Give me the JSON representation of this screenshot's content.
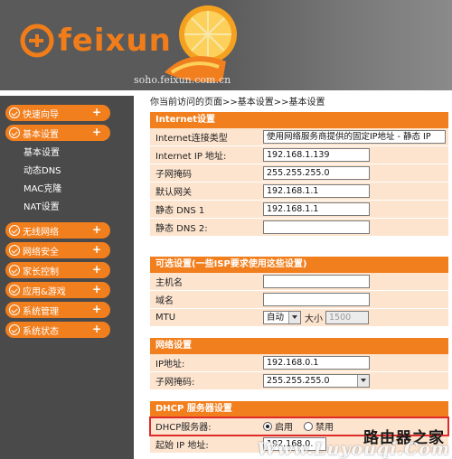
{
  "header": {
    "brand": "feixun",
    "domain": "soho.feixun.com.cn",
    "brand_color": "#f07d1a"
  },
  "sidebar": {
    "items": [
      {
        "label": "快速向导",
        "icon": "check-circle-icon"
      },
      {
        "label": "基本设置",
        "icon": "check-circle-icon"
      },
      {
        "label": "无线网络",
        "icon": "check-circle-icon"
      },
      {
        "label": "网络安全",
        "icon": "check-circle-icon"
      },
      {
        "label": "家长控制",
        "icon": "check-circle-icon"
      },
      {
        "label": "应用&游戏",
        "icon": "check-circle-icon"
      },
      {
        "label": "系统管理",
        "icon": "check-circle-icon"
      },
      {
        "label": "系统状态",
        "icon": "check-circle-icon"
      }
    ],
    "plus": "+",
    "basic_sub": [
      "基本设置",
      "动态DNS",
      "MAC克隆",
      "NAT设置"
    ]
  },
  "breadcrumb": "你当前访问的页面>>基本设置>>基本设置",
  "internet": {
    "title": "Internet设置",
    "conn_type_label": "Internet连接类型",
    "conn_type_value": "使用网络服务商提供的固定IP地址 - 静态 IP",
    "ip_label": "Internet IP 地址:",
    "ip_value": "192.168.1.139",
    "mask_label": "子网掩码",
    "mask_value": "255.255.255.0",
    "gw_label": "默认网关",
    "gw_value": "192.168.1.1",
    "dns1_label": "静态 DNS 1",
    "dns1_value": "192.168.1.1",
    "dns2_label": "静态 DNS 2:",
    "dns2_value": ""
  },
  "optional": {
    "title": "可选设置(一些ISP要求使用这些设置)",
    "host_label": "主机名",
    "host_value": "",
    "domain_label": "域名",
    "domain_value": "",
    "mtu_label": "MTU",
    "mtu_mode": "自动",
    "size_label": "大小",
    "size_value": "1500"
  },
  "network": {
    "title": "网络设置",
    "ip_label": "IP地址:",
    "ip_value": "192.168.0.1",
    "mask_label": "子网掩码:",
    "mask_value": "255.255.255.0"
  },
  "dhcp": {
    "title": "DHCP 服务器设置",
    "server_label": "DHCP服务器:",
    "enable_label": "启用",
    "disable_label": "禁用",
    "start_label": "起始 IP 地址:",
    "start_value": "192.168.0."
  },
  "watermark": {
    "line1": "路由器之家",
    "line2": "Www.Luyouqi.Com"
  }
}
